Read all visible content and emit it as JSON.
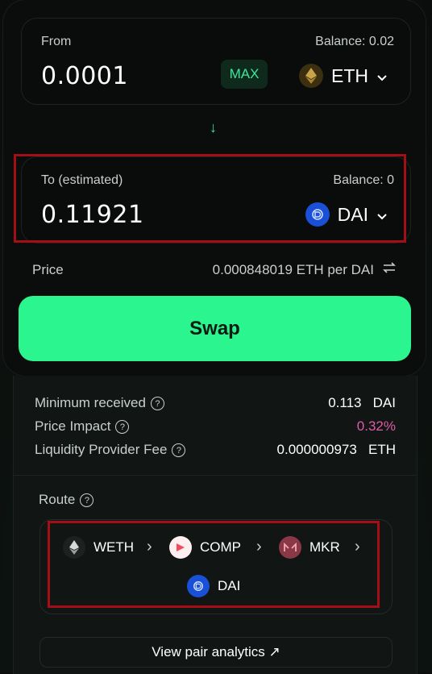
{
  "from": {
    "label": "From",
    "balance": "Balance: 0.02",
    "amount": "0.0001",
    "max_label": "MAX",
    "token": "ETH"
  },
  "arrow": "↓",
  "to": {
    "label": "To (estimated)",
    "balance": "Balance: 0",
    "amount": "0.11921",
    "token": "DAI"
  },
  "price": {
    "label": "Price",
    "value": "0.000848019 ETH per DAI"
  },
  "swap_label": "Swap",
  "details": {
    "min_received": {
      "label": "Minimum received",
      "value": "0.113",
      "unit": "DAI"
    },
    "price_impact": {
      "label": "Price Impact",
      "value": "0.32%"
    },
    "lp_fee": {
      "label": "Liquidity Provider Fee",
      "value": "0.000000973",
      "unit": "ETH"
    }
  },
  "route": {
    "label": "Route",
    "hops": [
      "WETH",
      "COMP",
      "MKR",
      "DAI"
    ]
  },
  "analytics_label": "View pair analytics ↗",
  "colors": {
    "accent": "#2bf58f",
    "impact": "#e05aa6",
    "highlight": "#a30f14"
  }
}
